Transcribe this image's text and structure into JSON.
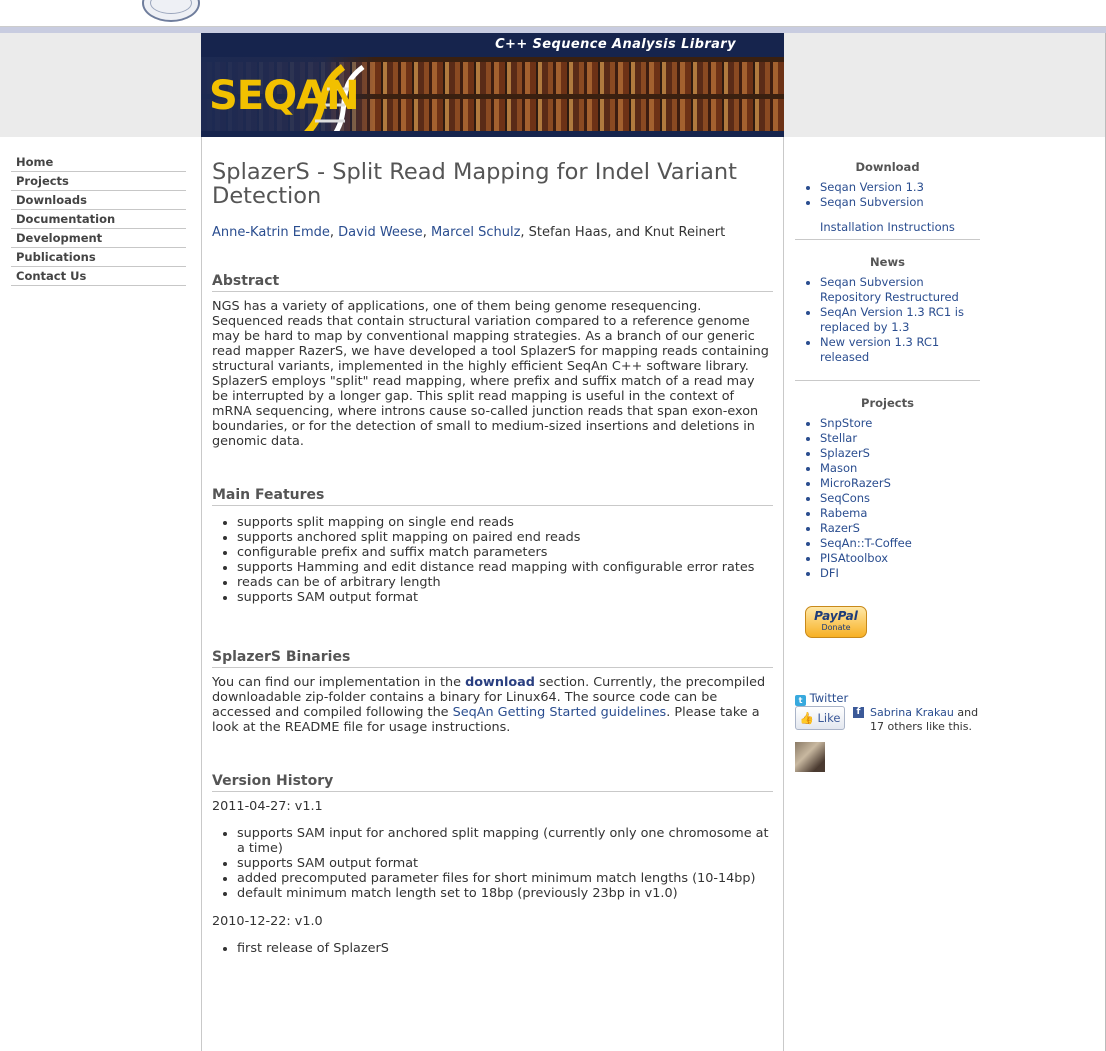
{
  "banner": {
    "tagline": "C++ Sequence Analysis Library",
    "logo": "SEQAN"
  },
  "nav": {
    "items": [
      "Home",
      "Projects",
      "Downloads",
      "Documentation",
      "Development",
      "Publications",
      "Contact Us"
    ]
  },
  "main": {
    "title": "SplazerS - Split Read Mapping for Indel Variant Detection",
    "authors": {
      "linked": [
        "Anne-Katrin Emde",
        "David Weese",
        "Marcel Schulz"
      ],
      "sep1": ", ",
      "sep2": ", ",
      "sep3": ", ",
      "rest": "Stefan Haas, and Knut Reinert"
    },
    "abstract": {
      "title": "Abstract",
      "text": "NGS has a variety of applications, one of them being genome resequencing. Sequenced reads that contain structural variation compared to a reference genome may be hard to map by conventional mapping strategies. As a branch of our generic read mapper RazerS, we have developed a tool SplazerS for mapping reads containing structural variants, implemented in the highly efficient SeqAn C++ software library. SplazerS employs \"split\" read mapping, where prefix and suffix match of a read may be interrupted by a longer gap. This split read mapping is useful in the context of mRNA sequencing, where introns cause so-called junction reads that span exon-exon boundaries, or for the detection of small to medium-sized insertions and deletions in genomic data."
    },
    "features": {
      "title": "Main Features",
      "items": [
        "supports split mapping on single end reads",
        "supports anchored split mapping on paired end reads",
        "configurable prefix and suffix match parameters",
        "supports Hamming and edit distance read mapping with configurable error rates",
        "reads can be of arbitrary length",
        "supports SAM output format"
      ]
    },
    "binaries": {
      "title": "SplazerS Binaries",
      "text1": "You can find our implementation in the ",
      "link1": "download",
      "text2": " section. Currently, the precompiled downloadable zip-folder contains a binary for Linux64. The source code can be accessed and compiled following the ",
      "link2": "SeqAn Getting Started guidelines",
      "text3": ". Please take a look at the README file for usage instructions."
    },
    "history": {
      "title": "Version History",
      "v1": {
        "label": "2011-04-27: v1.1",
        "items": [
          "supports SAM input for anchored split mapping (currently only one chromosome at a time)",
          "supports SAM output format",
          "added precomputed parameter files for short minimum match lengths (10-14bp)",
          "default minimum match length set to 18bp (previously 23bp in v1.0)"
        ]
      },
      "v0": {
        "label": "2010-12-22: v1.0",
        "items": [
          "first release of SplazerS"
        ]
      }
    }
  },
  "sidebar": {
    "download": {
      "title": "Download",
      "items": [
        "Seqan Version 1.3",
        "Seqan Subversion"
      ],
      "extra": "Installation Instructions"
    },
    "news": {
      "title": "News",
      "items": [
        "Seqan Subversion Repository Restructured",
        "SeqAn Version 1.3 RC1 is replaced by 1.3",
        "New version 1.3 RC1 released"
      ]
    },
    "projects": {
      "title": "Projects",
      "items": [
        "SnpStore",
        "Stellar",
        "SplazerS",
        "Mason",
        "MicroRazerS",
        "SeqCons",
        "Rabema",
        "RazerS",
        "SeqAn::T-Coffee",
        "PISAtoolbox",
        "DFI"
      ]
    },
    "paypal": {
      "main": "PayPal",
      "sub": "Donate"
    },
    "twitter": "Twitter",
    "like": "Like",
    "fb_name": "Sabrina Krakau",
    "fb_rest": " and 17 others like this."
  }
}
